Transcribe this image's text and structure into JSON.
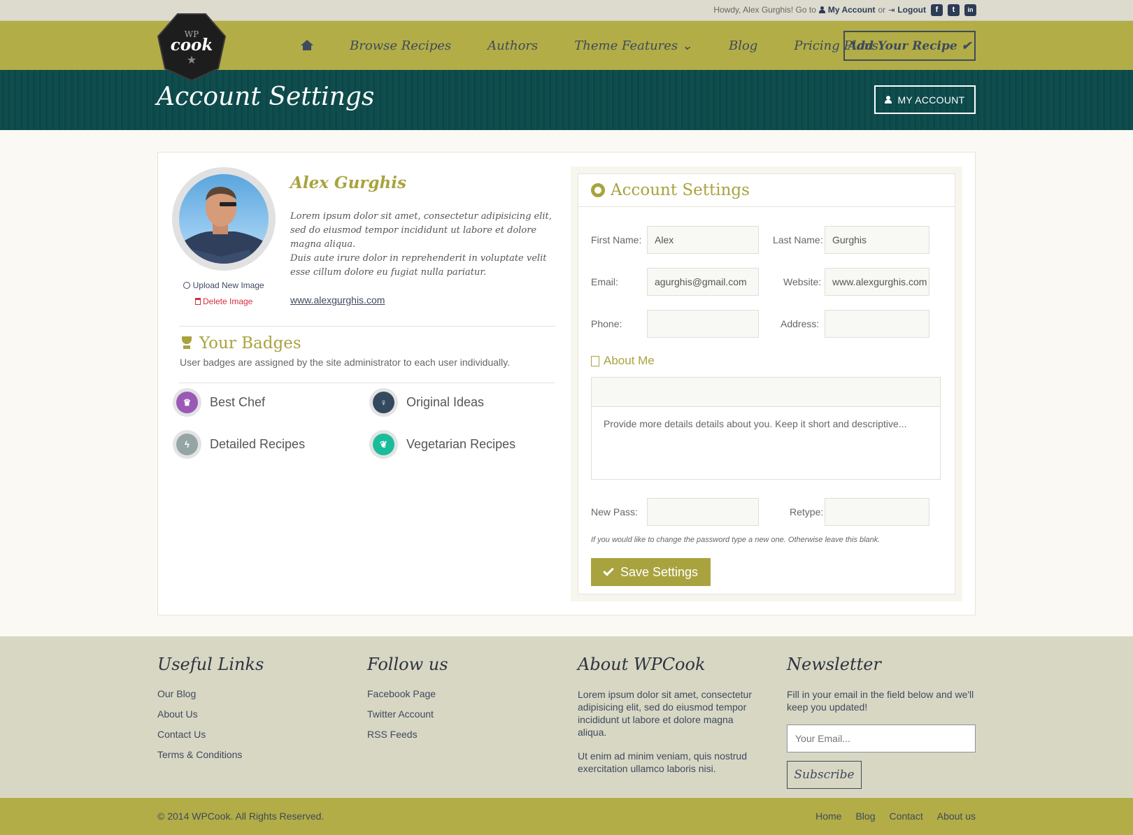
{
  "topbar": {
    "greeting": "Howdy, Alex Gurghis! Go to",
    "my_account": "My Account",
    "or": "or",
    "logout": "Logout",
    "social": [
      "f",
      "t",
      "in"
    ]
  },
  "logo": {
    "wp": "WP",
    "cook": "cook",
    "star": "★"
  },
  "nav": {
    "items": [
      "Browse Recipes",
      "Authors",
      "Theme Features ⌄",
      "Blog",
      "Pricing Plans"
    ],
    "add_recipe": "Add Your Recipe"
  },
  "header": {
    "title": "Account Settings",
    "my_account_button": "MY ACCOUNT"
  },
  "profile": {
    "name": "Alex Gurghis",
    "bio1": "Lorem ipsum dolor sit amet, consectetur adipisicing elit, sed do eiusmod tempor incididunt ut labore et dolore magna aliqua.",
    "bio2": "Duis aute irure dolor in reprehenderit in voluptate velit esse cillum dolore eu fugiat nulla pariatur.",
    "url": "www.alexgurghis.com",
    "upload": "Upload New Image",
    "delete": "Delete Image"
  },
  "badges": {
    "title": "Your Badges",
    "description": "User badges are assigned by the site administrator to each user individually.",
    "items": [
      {
        "label": "Best Chef",
        "color": "#9b59b6"
      },
      {
        "label": "Original Ideas",
        "color": "#34495e"
      },
      {
        "label": "Detailed Recipes",
        "color": "#95a5a6"
      },
      {
        "label": "Vegetarian Recipes",
        "color": "#1abc9c"
      }
    ]
  },
  "settings": {
    "title": "Account Settings",
    "first_name_label": "First Name:",
    "first_name": "Alex",
    "last_name_label": "Last Name:",
    "last_name": "Gurghis",
    "email_label": "Email:",
    "email": "agurghis@gmail.com",
    "website_label": "Website:",
    "website": "www.alexgurghis.com",
    "phone_label": "Phone:",
    "phone": "",
    "address_label": "Address:",
    "address": "",
    "about_title": "About Me",
    "about_placeholder": "Provide more details details about you. Keep it short and descriptive...",
    "new_pass_label": "New Pass:",
    "retype_label": "Retype:",
    "pass_note": "If you would like to change the password type a new one. Otherwise leave this blank.",
    "save_button": "Save Settings"
  },
  "footer": {
    "useful_links_title": "Useful Links",
    "useful_links": [
      "Our Blog",
      "About Us",
      "Contact Us",
      "Terms & Conditions"
    ],
    "follow_title": "Follow us",
    "follow_links": [
      "Facebook Page",
      "Twitter Account",
      "RSS Feeds"
    ],
    "about_title": "About WPCook",
    "about_p1": "Lorem ipsum dolor sit amet, consectetur adipisicing elit, sed do eiusmod tempor incididunt ut labore et dolore magna aliqua.",
    "about_p2": "Ut enim ad minim veniam, quis nostrud exercitation ullamco laboris nisi.",
    "newsletter_title": "Newsletter",
    "newsletter_text": "Fill in your email in the field below and we'll keep you updated!",
    "email_placeholder": "Your Email...",
    "subscribe": "Subscribe"
  },
  "bottombar": {
    "copyright": "© 2014 WPCook. All Rights Reserved.",
    "links": [
      "Home",
      "Blog",
      "Contact",
      "About us"
    ]
  }
}
